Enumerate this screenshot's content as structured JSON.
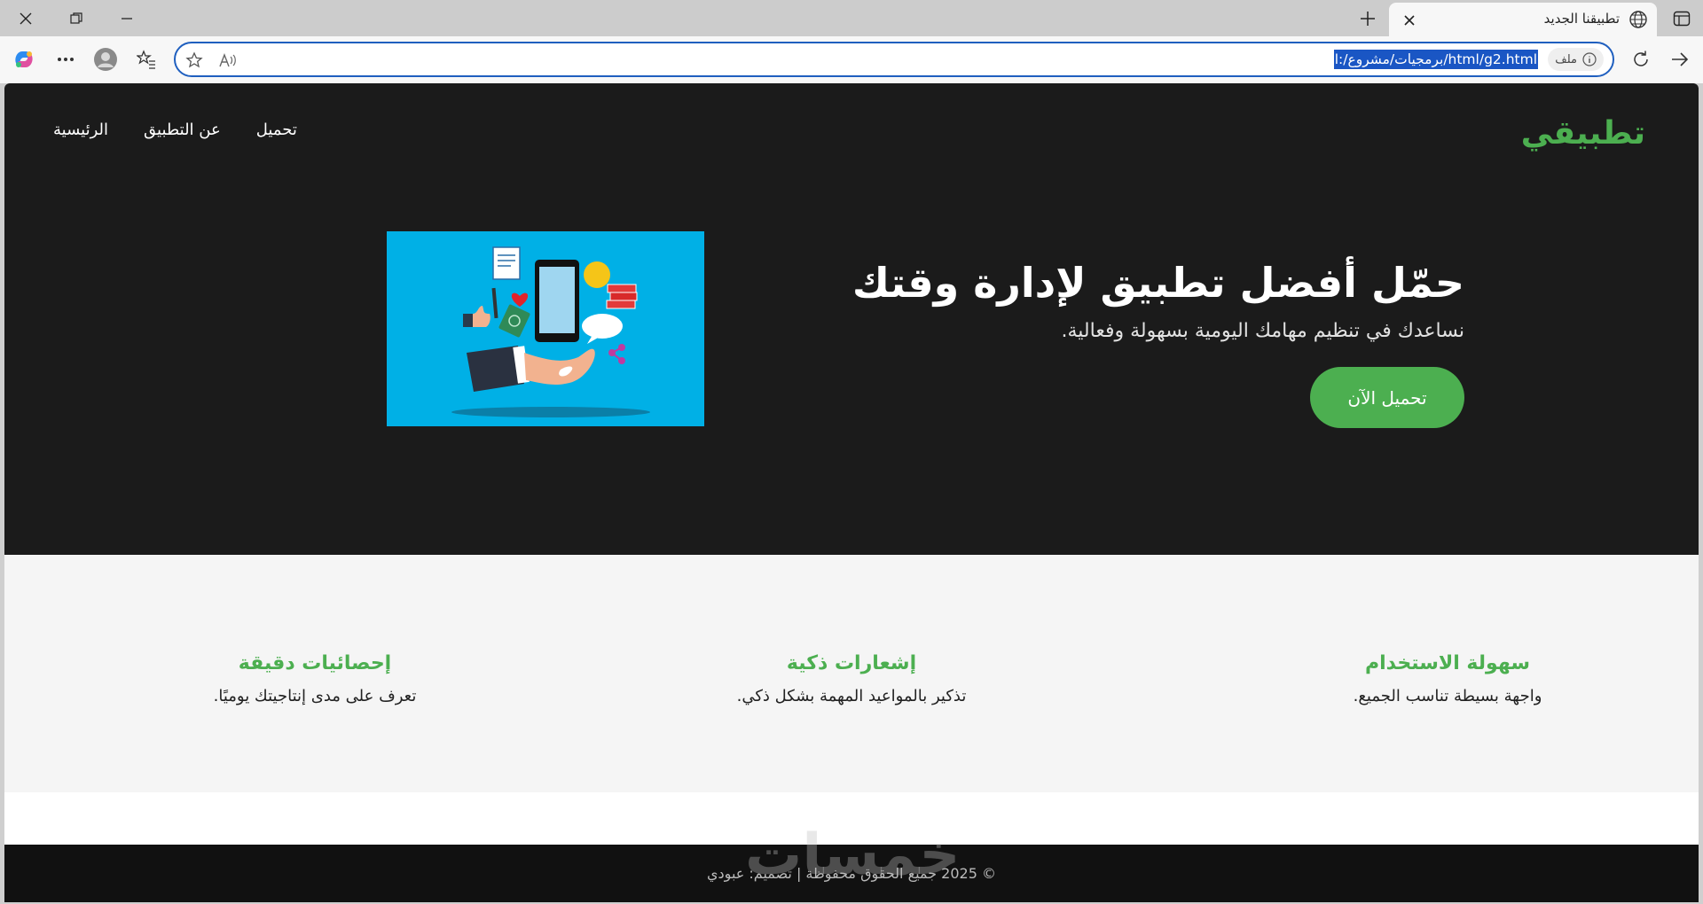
{
  "browser": {
    "tab_title": "تطبيقنا الجديد",
    "url": "l:/برمجيات/مشروع/html/g2.html",
    "file_label": "ملف"
  },
  "site": {
    "brand": "تطبيقي",
    "nav": [
      "الرئيسية",
      "عن التطبيق",
      "تحميل"
    ],
    "hero": {
      "title": "حمّل أفضل تطبيق لإدارة وقتك",
      "subtitle": "نساعدك في تنظيم مهامك اليومية بسهولة وفعالية.",
      "cta": "تحميل الآن"
    },
    "features": [
      {
        "title": "سهولة الاستخدام",
        "text": "واجهة بسيطة تناسب الجميع."
      },
      {
        "title": "إشعارات ذكية",
        "text": "تذكير بالمواعيد المهمة بشكل ذكي."
      },
      {
        "title": "إحصائيات دقيقة",
        "text": "تعرف على مدى إنتاجيتك يوميًا."
      }
    ],
    "footer": "© 2025 جميع الحقوق محفوظة | تصميم: عبودي",
    "watermark": "خمسات"
  },
  "colors": {
    "accent": "#4caf50",
    "hero_bg": "#1b1b1b",
    "image_bg": "#00b0e6"
  }
}
